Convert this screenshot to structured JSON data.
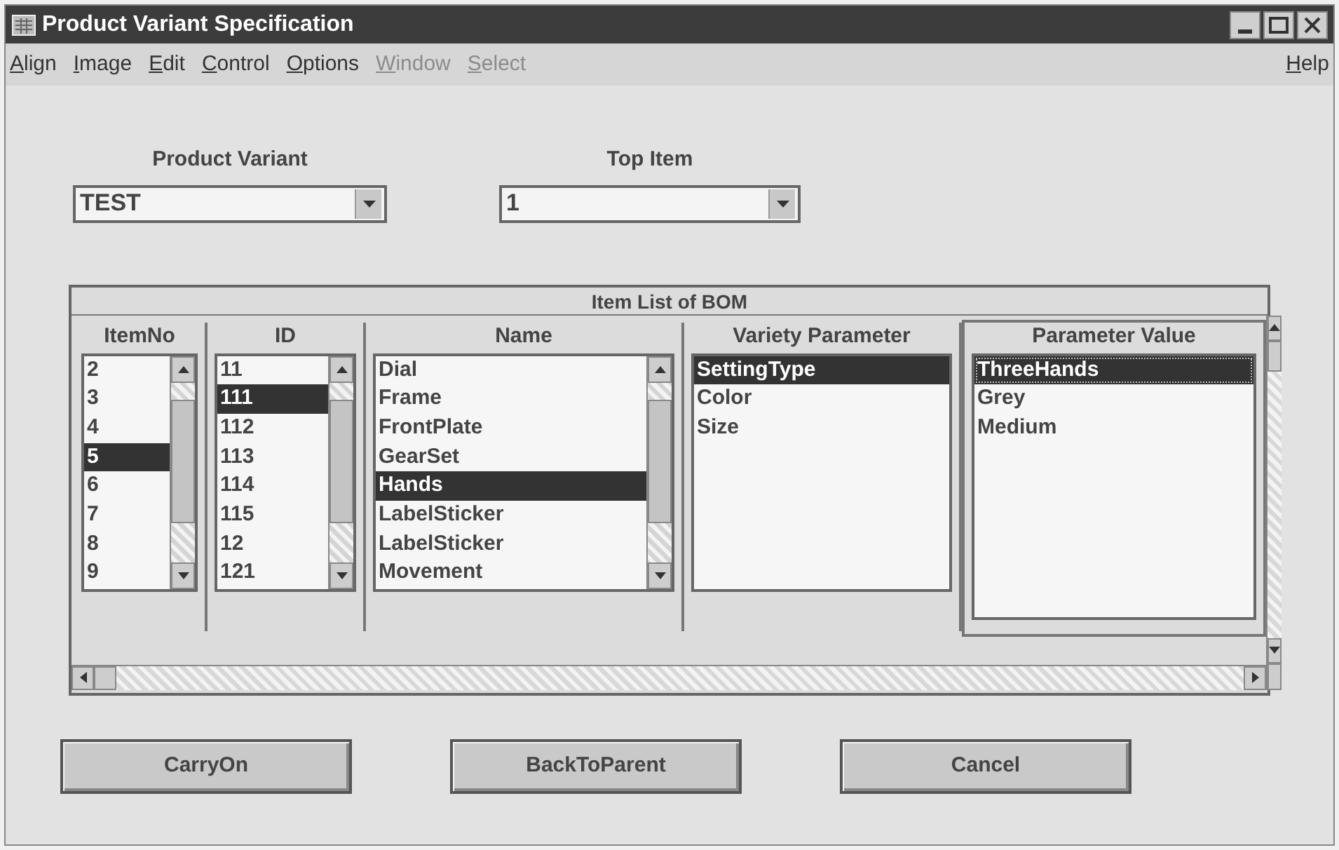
{
  "window": {
    "title": "Product Variant Specification"
  },
  "menu": [
    {
      "label": "Align",
      "disabled": false
    },
    {
      "label": "Image",
      "disabled": false
    },
    {
      "label": "Edit",
      "disabled": false
    },
    {
      "label": "Control",
      "disabled": false
    },
    {
      "label": "Options",
      "disabled": false
    },
    {
      "label": "Window",
      "disabled": true
    },
    {
      "label": "Select",
      "disabled": true
    }
  ],
  "help_menu": {
    "label": "Help"
  },
  "product_variant": {
    "label": "Product Variant",
    "value": "TEST"
  },
  "top_item": {
    "label": "Top Item",
    "value": "1"
  },
  "item_list": {
    "title": "Item List of BOM",
    "columns": [
      {
        "heading": "ItemNo",
        "kind": "scrolled",
        "focused": false,
        "items": [
          {
            "text": "2",
            "selected": false
          },
          {
            "text": "3",
            "selected": false
          },
          {
            "text": "4",
            "selected": false
          },
          {
            "text": "5",
            "selected": true
          },
          {
            "text": "6",
            "selected": false
          },
          {
            "text": "7",
            "selected": false
          },
          {
            "text": "8",
            "selected": false
          },
          {
            "text": "9",
            "selected": false
          }
        ]
      },
      {
        "heading": "ID",
        "kind": "scrolled",
        "focused": false,
        "items": [
          {
            "text": "11",
            "selected": false
          },
          {
            "text": "111",
            "selected": true
          },
          {
            "text": "112",
            "selected": false
          },
          {
            "text": "113",
            "selected": false
          },
          {
            "text": "114",
            "selected": false
          },
          {
            "text": "115",
            "selected": false
          },
          {
            "text": "12",
            "selected": false
          },
          {
            "text": "121",
            "selected": false
          }
        ]
      },
      {
        "heading": "Name",
        "kind": "scrolled",
        "focused": false,
        "items": [
          {
            "text": "Dial",
            "selected": false
          },
          {
            "text": "Frame",
            "selected": false
          },
          {
            "text": "FrontPlate",
            "selected": false
          },
          {
            "text": "GearSet",
            "selected": false
          },
          {
            "text": "Hands",
            "selected": true
          },
          {
            "text": "LabelSticker",
            "selected": false
          },
          {
            "text": "LabelSticker",
            "selected": false
          },
          {
            "text": "Movement",
            "selected": false
          }
        ]
      },
      {
        "heading": "Variety Parameter",
        "kind": "plain",
        "focused": false,
        "items": [
          {
            "text": "SettingType",
            "selected": true
          },
          {
            "text": "Color",
            "selected": false
          },
          {
            "text": "Size",
            "selected": false
          }
        ]
      },
      {
        "heading": "Parameter Value",
        "kind": "plain",
        "focused": true,
        "items": [
          {
            "text": "ThreeHands",
            "selected": true
          },
          {
            "text": "Grey",
            "selected": false
          },
          {
            "text": "Medium",
            "selected": false
          }
        ]
      }
    ]
  },
  "buttons": [
    "CarryOn",
    "BackToParent",
    "Cancel"
  ]
}
